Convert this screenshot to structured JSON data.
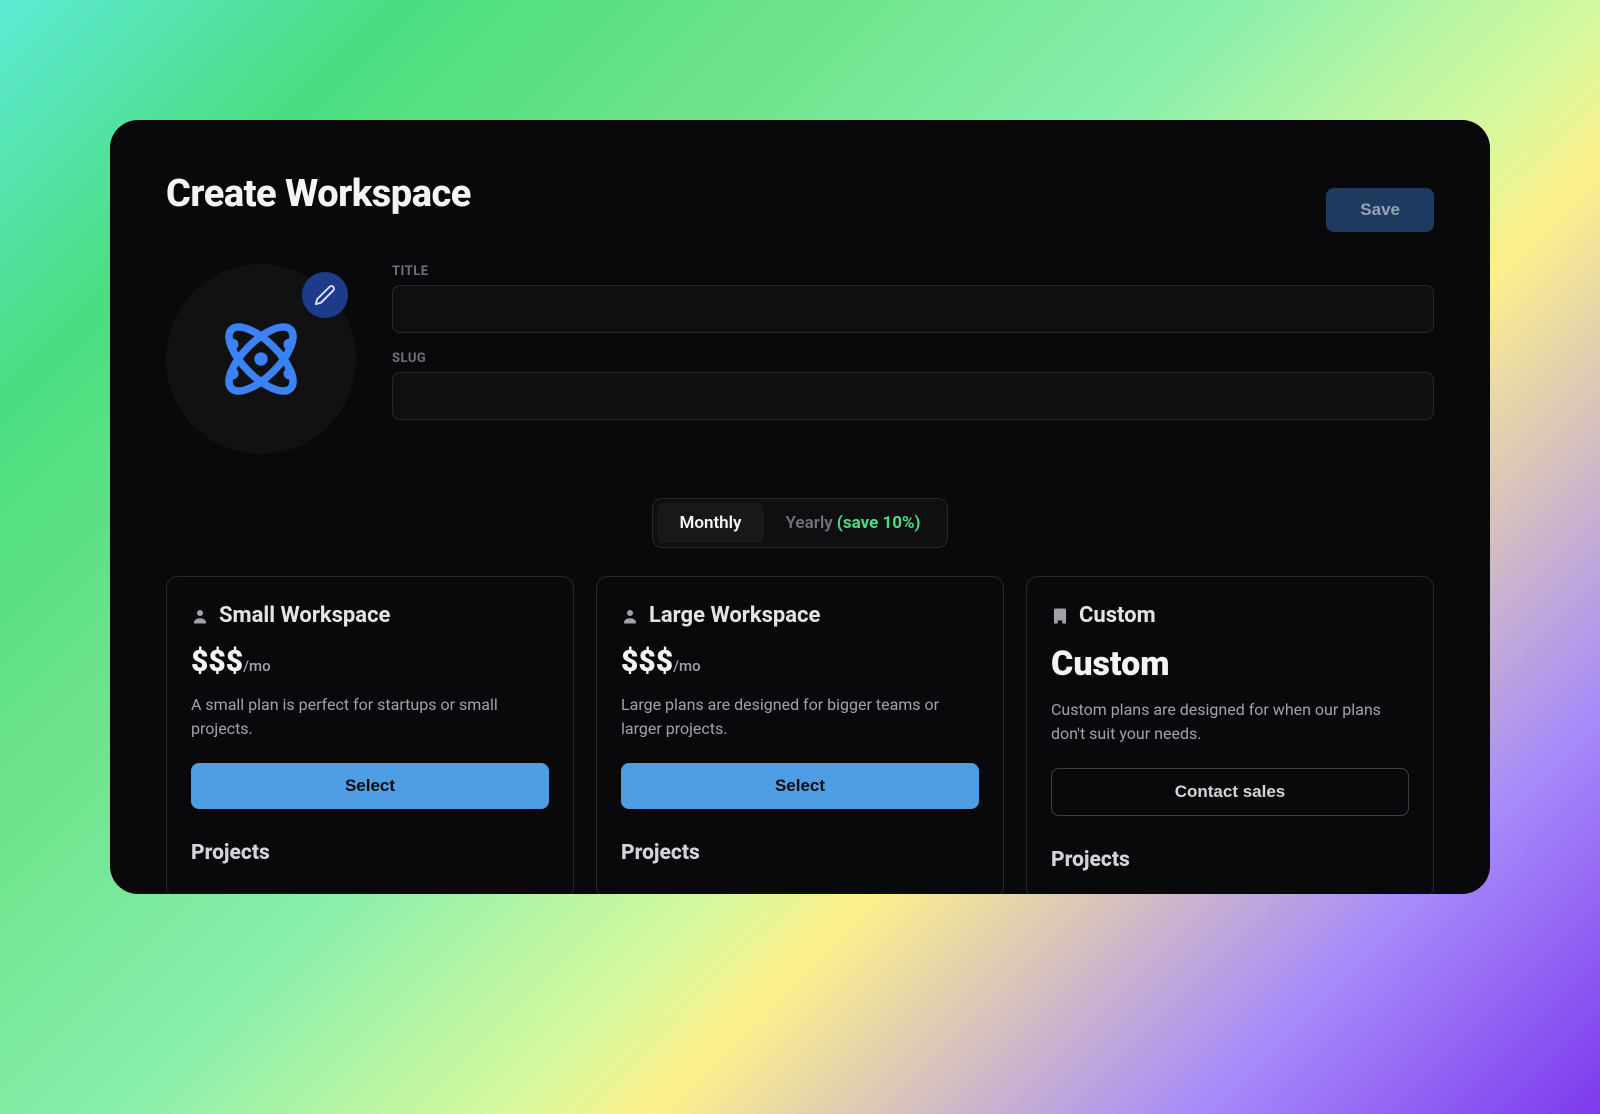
{
  "header": {
    "title": "Create Workspace",
    "save_label": "Save"
  },
  "form": {
    "title_label": "TITLE",
    "title_value": "",
    "slug_label": "SLUG",
    "slug_value": ""
  },
  "billing": {
    "monthly_label": "Monthly",
    "yearly_label": "Yearly",
    "yearly_save": "(save 10%)",
    "active": "monthly"
  },
  "plans": [
    {
      "icon": "person-icon",
      "name": "Small Workspace",
      "price": "$$$",
      "unit": "/mo",
      "custom_price": "",
      "description": "A small plan is perfect for startups or small projects.",
      "button_label": "Select",
      "button_style": "primary",
      "section_title": "Projects"
    },
    {
      "icon": "person-icon",
      "name": "Large Workspace",
      "price": "$$$",
      "unit": "/mo",
      "custom_price": "",
      "description": "Large plans are designed for bigger teams or larger projects.",
      "button_label": "Select",
      "button_style": "primary",
      "section_title": "Projects"
    },
    {
      "icon": "building-icon",
      "name": "Custom",
      "price": "",
      "unit": "",
      "custom_price": "Custom",
      "description": "Custom plans are designed for when our plans don't suit your needs.",
      "button_label": "Contact sales",
      "button_style": "outline",
      "section_title": "Projects"
    }
  ]
}
